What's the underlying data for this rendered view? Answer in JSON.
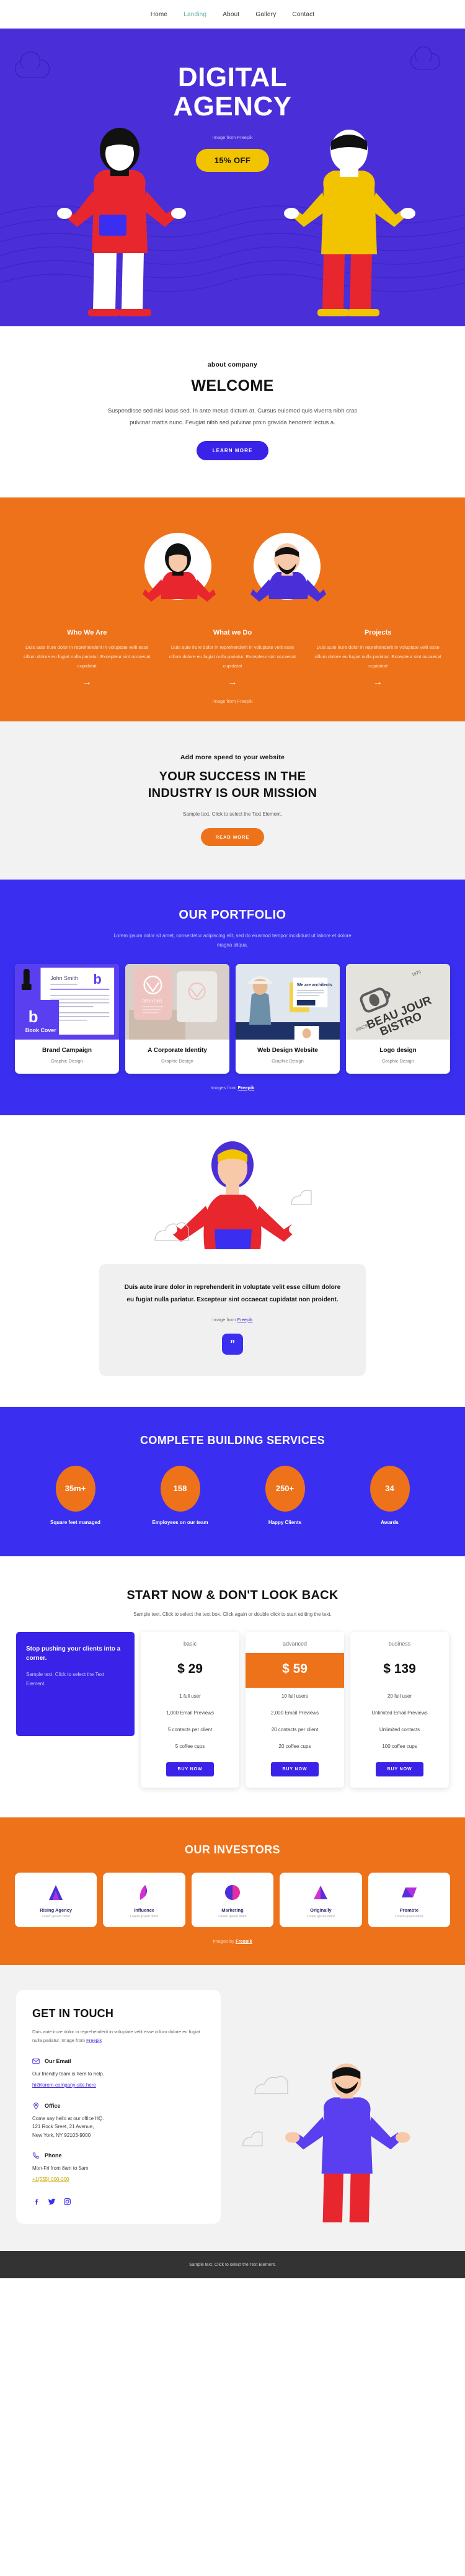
{
  "nav": {
    "items": [
      {
        "label": "Home",
        "active": false
      },
      {
        "label": "Landing",
        "active": true
      },
      {
        "label": "About",
        "active": false
      },
      {
        "label": "Gallery",
        "active": false
      },
      {
        "label": "Contact",
        "active": false
      }
    ]
  },
  "hero": {
    "title_line1": "DIGITAL",
    "title_line2": "AGENCY",
    "credit": "Image from Freepik",
    "offer_button": "15% OFF",
    "bg_color": "#4a2fd8",
    "accent_color": "#f2c400"
  },
  "welcome": {
    "eyebrow": "about company",
    "heading": "WELCOME",
    "body": "Suspendisse sed nisi lacus sed. In ante metus dictum at. Cursus euismod quis viverra nibh cras pulvinar mattis nunc. Feugiat nibh sed pulvinar proin gravida hendrerit lectus a.",
    "button": "LEARN MORE"
  },
  "team": {
    "bg_color": "#ee7219",
    "credit": "Image from Freepik",
    "columns": [
      {
        "title": "Who We Are",
        "text": "Duis aute irure dolor in reprehenderit in voluptate velit esse cillum dolore eu fugiat nulla pariatur. Excepteur sint occaecat cupidatat",
        "arrow": "→"
      },
      {
        "title": "What we Do",
        "text": "Duis aute irure dolor in reprehenderit in voluptate velit esse cillum dolore eu fugiat nulla pariatur. Excepteur sint occaecat cupidatat",
        "arrow": "→"
      },
      {
        "title": "Projects",
        "text": "Duis aute irure dolor in reprehenderit in voluptate velit esse cillum dolore eu fugiat nulla pariatur. Excepteur sint occaecat cupidatat",
        "arrow": "→"
      }
    ]
  },
  "mission": {
    "eyebrow": "Add more speed to your website",
    "heading_line1": "YOUR SUCCESS IN THE",
    "heading_line2": "INDUSTRY IS OUR MISSION",
    "sub": "Sample text. Click to select the Text Element.",
    "button": "READ MORE"
  },
  "portfolio": {
    "bg_color": "#3a2ff0",
    "heading": "OUR PORTFOLIO",
    "sub": "Lorem ipsum dolor sit amet, consectetur adipiscing elit, sed do eiusmod tempor incididunt ut labore et dolore magna aliqua.",
    "credit_prefix": "Images from ",
    "credit_link": "Freepik",
    "cards": [
      {
        "name": "Brand Campaign",
        "category": "Graphic Design",
        "thumb_caption": "Book Cover",
        "thumb_name": "John Smith"
      },
      {
        "name": "A Corporate Identity",
        "category": "Graphic Design",
        "thumb_caption": "DEO YOKO",
        "thumb_name": ""
      },
      {
        "name": "Web Design Website",
        "category": "Graphic Design",
        "thumb_caption": "We are architects",
        "thumb_name": "LEARN MORE"
      },
      {
        "name": "Logo design",
        "category": "Graphic Design",
        "thumb_caption": "BEAU JOUR BISTRO",
        "thumb_name": "SINCE 1970"
      }
    ]
  },
  "quote": {
    "text": "Duis aute irure dolor in reprehenderit in voluptate velit esse cillum dolore eu fugiat nulla pariatur. Excepteur sint occaecat cupidatat non proident.",
    "credit_prefix": "Image from ",
    "credit_link": "Freepik",
    "badge": "”"
  },
  "stats": {
    "bg_color": "#3a2ff0",
    "heading": "COMPLETE BUILDING SERVICES",
    "items": [
      {
        "value": "35m+",
        "label": "Square feet managed"
      },
      {
        "value": "158",
        "label": "Employees on our team"
      },
      {
        "value": "250+",
        "label": "Happy Clients"
      },
      {
        "value": "34",
        "label": "Awards"
      }
    ]
  },
  "pricing": {
    "heading": "START NOW & DON'T LOOK BACK",
    "sub": "Sample text. Click to select the text box. Click again or double click to start editing the text.",
    "promo": {
      "heading": "Stop pushing your clients into a corner.",
      "text": "Sample text. Click to select the Text Element."
    },
    "plans": [
      {
        "name": "basic",
        "price": "$ 29",
        "featured": false,
        "features": [
          "1 full user",
          "1,000 Email Previews",
          "5 contacts per client",
          "5 coffee cups"
        ],
        "button": "BUY NOW"
      },
      {
        "name": "advanced",
        "price": "$ 59",
        "featured": true,
        "features": [
          "10 full users",
          "2,000 Email Previews",
          "20 contacts per client",
          "20 coffee cups"
        ],
        "button": "BUY NOW"
      },
      {
        "name": "business",
        "price": "$ 139",
        "featured": false,
        "features": [
          "20 full user",
          "Unlimited Email Previews",
          "Unlimited contacts",
          "100 coffee cups"
        ],
        "button": "BUY NOW"
      }
    ]
  },
  "investors": {
    "bg_color": "#ee7219",
    "heading": "OUR INVESTORS",
    "credit_prefix": "Images by ",
    "credit_link": "Freepik",
    "logos": [
      {
        "name": "Rising Agency",
        "desc": "Lorem ipsum dolor"
      },
      {
        "name": "Influence",
        "desc": "Lorem ipsum dolor"
      },
      {
        "name": "Marketing",
        "desc": "Lorem ipsum dolor"
      },
      {
        "name": "Originally",
        "desc": "Lorem ipsum dolor"
      },
      {
        "name": "Promote",
        "desc": "Lorem ipsum dolor"
      }
    ]
  },
  "contact": {
    "heading": "GET IN TOUCH",
    "intro": "Duis aute irure dolor in reprehenderit in voluptate velit esse cillum dolore eu fugiat nulla pariatur. Image from ",
    "intro_link": "Freepik",
    "blocks": [
      {
        "icon": "mail-icon",
        "label": "Our Email",
        "line": "Our friendly team is here to help.",
        "link": "hi@lorem-company-site.here",
        "link_style": "blue"
      },
      {
        "icon": "location-icon",
        "label": "Office",
        "line": "Come say hello at our office HQ.\n121 Rock Sreet, 21 Avenue,\nNew York, NY 92103-9000",
        "link": "",
        "link_style": ""
      },
      {
        "icon": "phone-icon",
        "label": "Phone",
        "line": "Mon-Fri from 8am to 5am",
        "link": "+1(555) 000-000",
        "link_style": "yellow"
      }
    ],
    "social": [
      {
        "name": "facebook-icon",
        "glyph": "f"
      },
      {
        "name": "twitter-icon",
        "glyph": "ᴠ"
      },
      {
        "name": "instagram-icon",
        "glyph": "□"
      }
    ]
  },
  "footer": {
    "text": "Sample text. Click to select the Text Element."
  }
}
